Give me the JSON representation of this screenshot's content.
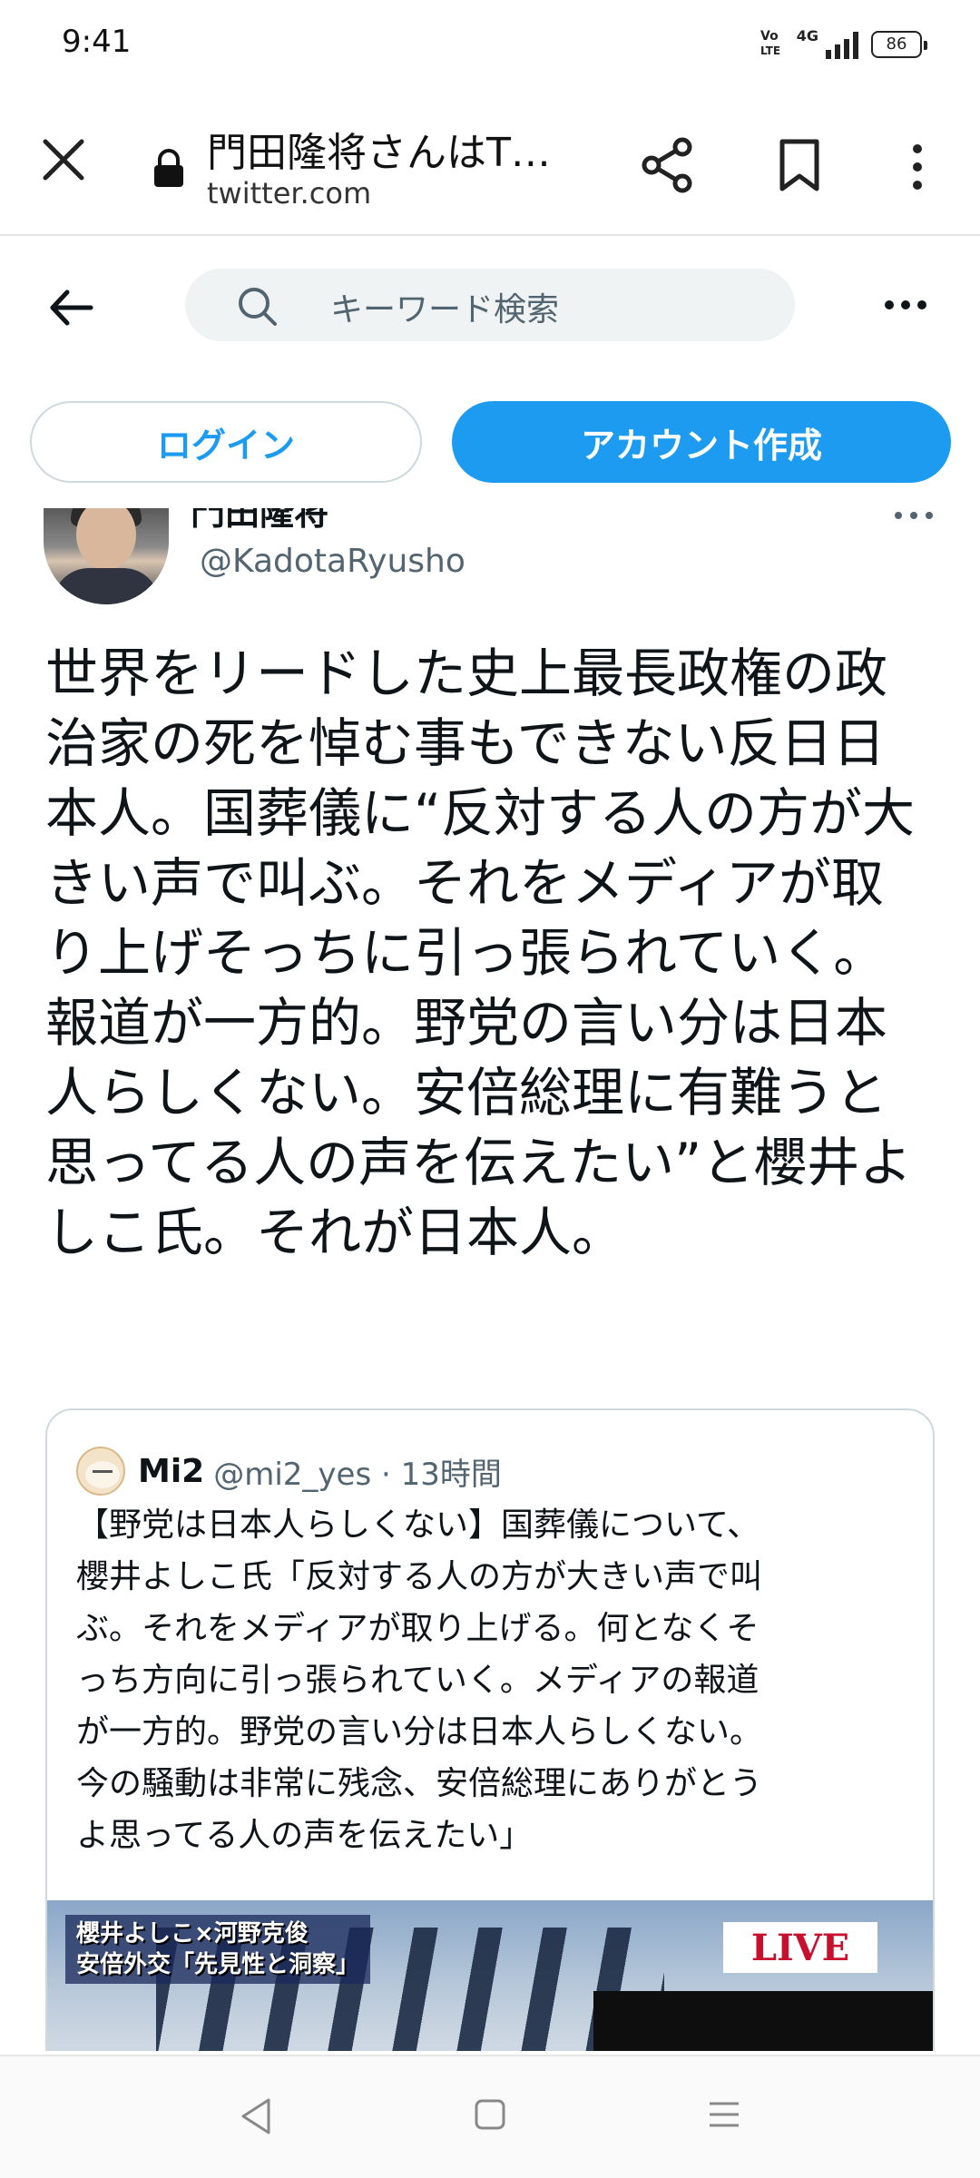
{
  "status_bar": {
    "time": "9:41",
    "volte": "Vo\nLTE",
    "network": "4G",
    "battery": "86"
  },
  "browser": {
    "page_title": "門田隆将さんはT…",
    "url": "twitter.com",
    "icons": [
      "close-icon",
      "lock-icon",
      "share-icon",
      "bookmark-icon",
      "more-vertical-icon"
    ]
  },
  "twitter_header": {
    "search_placeholder": "キーワード検索",
    "icons": [
      "back-arrow-icon",
      "search-icon",
      "more-horizontal-icon"
    ]
  },
  "auth": {
    "login_label": "ログイン",
    "signup_label": "アカウント作成"
  },
  "tweet": {
    "author_name": "門田隆将",
    "author_handle": "@KadotaRyusho",
    "text": "世界をリードした史上最長政権の政治家の死を悼む事もできない反日日本人。国葬儀に“反対する人の方が大きい声で叫ぶ。それをメディアが取り上げそっちに引っ張られていく。報道が一方的。野党の言い分は日本人らしくない。安倍総理に有難うと思ってる人の声を伝えたい”と櫻井よしこ氏。それが日本人。"
  },
  "quote": {
    "name": "Mi2",
    "handle_time": "@mi2_yes · 13時間",
    "text": "【野党は日本人らしくない】国葬儀について、\n櫻井よしこ氏「反対する人の方が大きい声で叫\nぶ。それをメディアが取り上げる。何となくそ\nっち方向に引っ張られていく。メディアの報道\nが一方的。野党の言い分は日本人らしくない。\n今の騒動は非常に残念、安倍総理にありがとう\nよ思ってる人の声を伝えたい」",
    "media_caption_line1": "櫻井よしこ×河野克俊",
    "media_caption_line2": "安倍外交「先見性と洞察」",
    "media_live": "LIVE"
  },
  "colors": {
    "accent": "#1d9bf0",
    "text": "#0f1419",
    "secondary": "#536471",
    "border": "#cfd9de"
  },
  "nav_bar": {
    "icons": [
      "nav-back-icon",
      "nav-home-icon",
      "nav-recents-icon"
    ]
  }
}
